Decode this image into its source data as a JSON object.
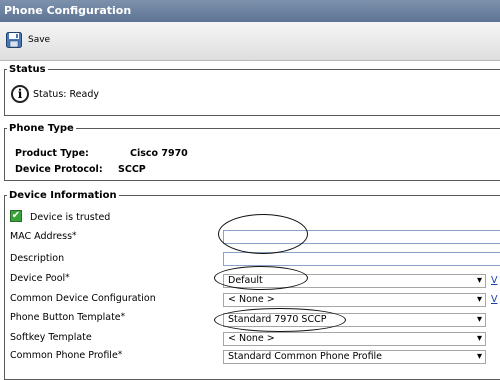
{
  "title": "Phone Configuration",
  "toolbar": {
    "save_label": "Save"
  },
  "status": {
    "legend": "Status",
    "text": "Status: Ready"
  },
  "phone_type": {
    "legend": "Phone Type",
    "product_label": "Product Type:",
    "product_value": "Cisco 7970",
    "protocol_label": "Device Protocol:",
    "protocol_value": "SCCP"
  },
  "device_info": {
    "legend": "Device Information",
    "trusted_text": "Device is trusted",
    "fields": [
      {
        "label": "MAC Address",
        "required": "*",
        "value": ""
      },
      {
        "label": "Description",
        "required": "",
        "value": ""
      },
      {
        "label": "Device Pool",
        "required": "*",
        "value": "Default",
        "link": "V"
      },
      {
        "label": "Common Device Configuration",
        "required": "",
        "value": "< None >",
        "link": "V"
      },
      {
        "label": "Phone Button Template",
        "required": "*",
        "value": "Standard 7970 SCCP"
      },
      {
        "label": "Softkey Template",
        "required": "",
        "value": "< None >"
      },
      {
        "label": "Common Phone Profile",
        "required": "*",
        "value": "Standard Common Phone Profile"
      }
    ]
  },
  "icons": {
    "save": "floppy-disk-icon",
    "status": "info-icon",
    "trusted": "checkmark-icon"
  }
}
